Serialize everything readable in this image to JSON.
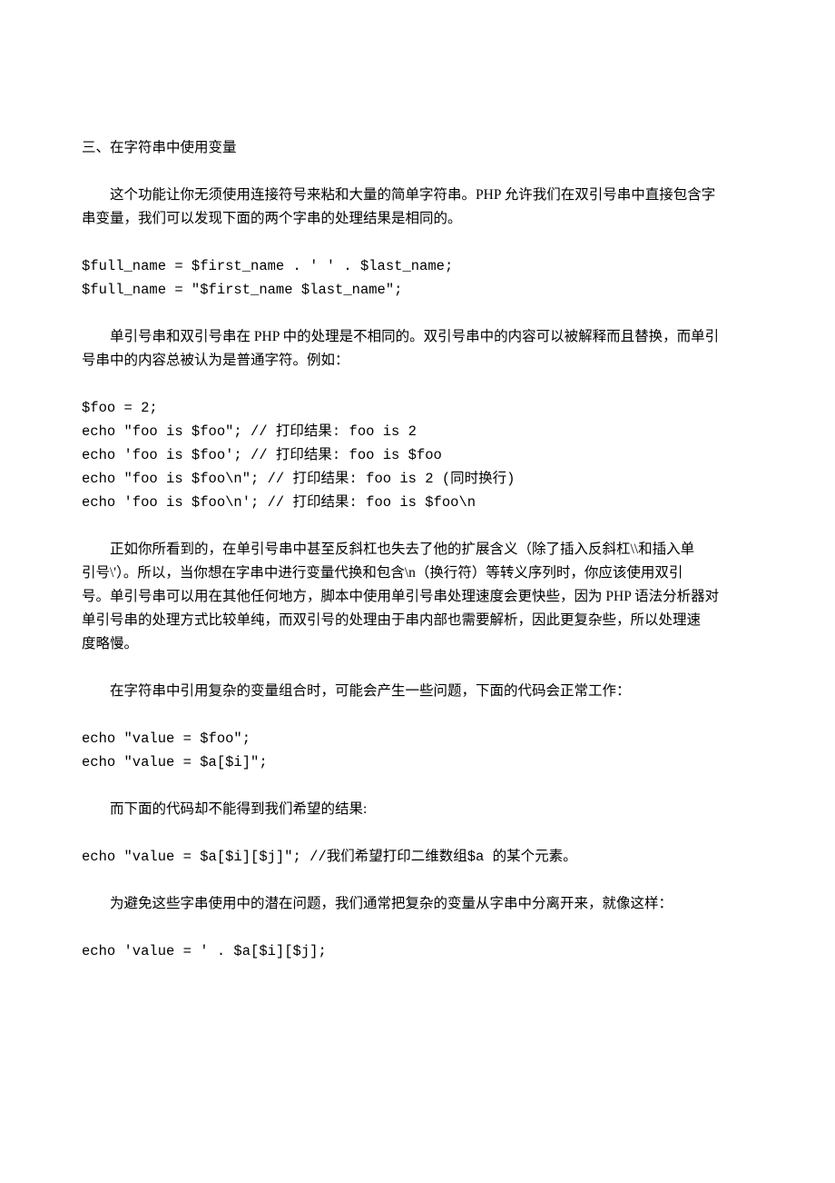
{
  "heading": "三、在字符串中使用变量",
  "p1_line1": "这个功能让你无须使用连接符号来粘和大量的简单字符串。PHP 允许我们在双引号串中直接包含字",
  "p1_line2": "串变量，我们可以发现下面的两个字串的处理结果是相同的。",
  "code1_l1": "$full_name = $first_name . ' ' . $last_name;",
  "code1_l2": "$full_name = \"$first_name $last_name\";",
  "p2_line1": "单引号串和双引号串在 PHP 中的处理是不相同的。双引号串中的内容可以被解释而且替换，而单引",
  "p2_line2": "号串中的内容总被认为是普通字符。例如：",
  "code2_l1": "$foo = 2;",
  "code2_l2": "echo \"foo is $foo\"; // 打印结果: foo is 2",
  "code2_l3": "echo 'foo is $foo'; // 打印结果: foo is $foo",
  "code2_l4": "echo \"foo is $foo\\n\"; // 打印结果: foo is 2 (同时换行)",
  "code2_l5": "echo 'foo is $foo\\n'; // 打印结果: foo is $foo\\n",
  "p3_line1": "正如你所看到的，在单引号串中甚至反斜杠也失去了他的扩展含义（除了插入反斜杠\\\\和插入单",
  "p3_line2": "引号\\'）。所以，当你想在字串中进行变量代换和包含\\n（换行符）等转义序列时，你应该使用双引",
  "p3_line3": "号。单引号串可以用在其他任何地方，脚本中使用单引号串处理速度会更快些，因为 PHP 语法分析器对",
  "p3_line4": "单引号串的处理方式比较单纯，而双引号的处理由于串内部也需要解析，因此更复杂些，所以处理速",
  "p3_line5": "度略慢。",
  "p4": "在字符串中引用复杂的变量组合时，可能会产生一些问题，下面的代码会正常工作：",
  "code3_l1": "echo \"value = $foo\";",
  "code3_l2": "echo \"value = $a[$i]\";",
  "p5": "而下面的代码却不能得到我们希望的结果:",
  "code4": "echo \"value = $a[$i][$j]\"; //我们希望打印二维数组$a 的某个元素。",
  "p6": "为避免这些字串使用中的潜在问题，我们通常把复杂的变量从字串中分离开来，就像这样：",
  "code5": "echo 'value = ' . $a[$i][$j];"
}
